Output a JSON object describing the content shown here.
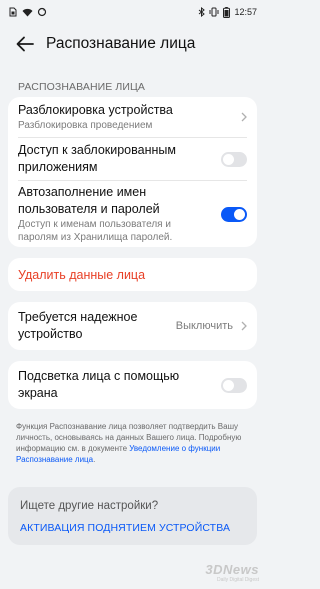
{
  "status_bar": {
    "left_icons": [
      "sim-icon",
      "wifi-icon",
      "sync-icon"
    ],
    "right_icons": [
      "bluetooth-icon",
      "vibrate-icon",
      "battery-icon"
    ],
    "time": "12:57"
  },
  "header": {
    "title": "Распознавание лица"
  },
  "section": {
    "label": "РАСПОЗНАВАНИЕ ЛИЦА"
  },
  "settings": {
    "unlock": {
      "title": "Разблокировка устройства",
      "subtitle": "Разблокировка проведением"
    },
    "locked_apps": {
      "title": "Доступ к заблокированным приложениям",
      "enabled": false
    },
    "autofill": {
      "title": "Автозаполнение имен пользователя и паролей",
      "subtitle": "Доступ к именам пользователя и паролям из Хранилища паролей.",
      "enabled": true
    }
  },
  "delete": {
    "label": "Удалить данные лица"
  },
  "trusted_device": {
    "title": "Требуется надежное устройство",
    "value": "Выключить"
  },
  "screen_light": {
    "title": "Подсветка лица с помощью экрана",
    "enabled": false
  },
  "footnote": {
    "text": "Функция Распознавание лица позволяет подтвердить Вашу личность, основываясь на данных Вашего лица. Подробную информацию см. в документе ",
    "link": "Уведомление о функции Распознавание лица",
    "end": "."
  },
  "suggestions": {
    "question": "Ищете другие настройки?",
    "link": "АКТИВАЦИЯ ПОДНЯТИЕМ УСТРОЙСТВА"
  },
  "watermark": {
    "logo": "3DNews",
    "tagline": "Daily Digital Digest"
  },
  "colors": {
    "accent": "#0a59f7",
    "danger": "#e84026",
    "background": "#f1f3f5"
  }
}
